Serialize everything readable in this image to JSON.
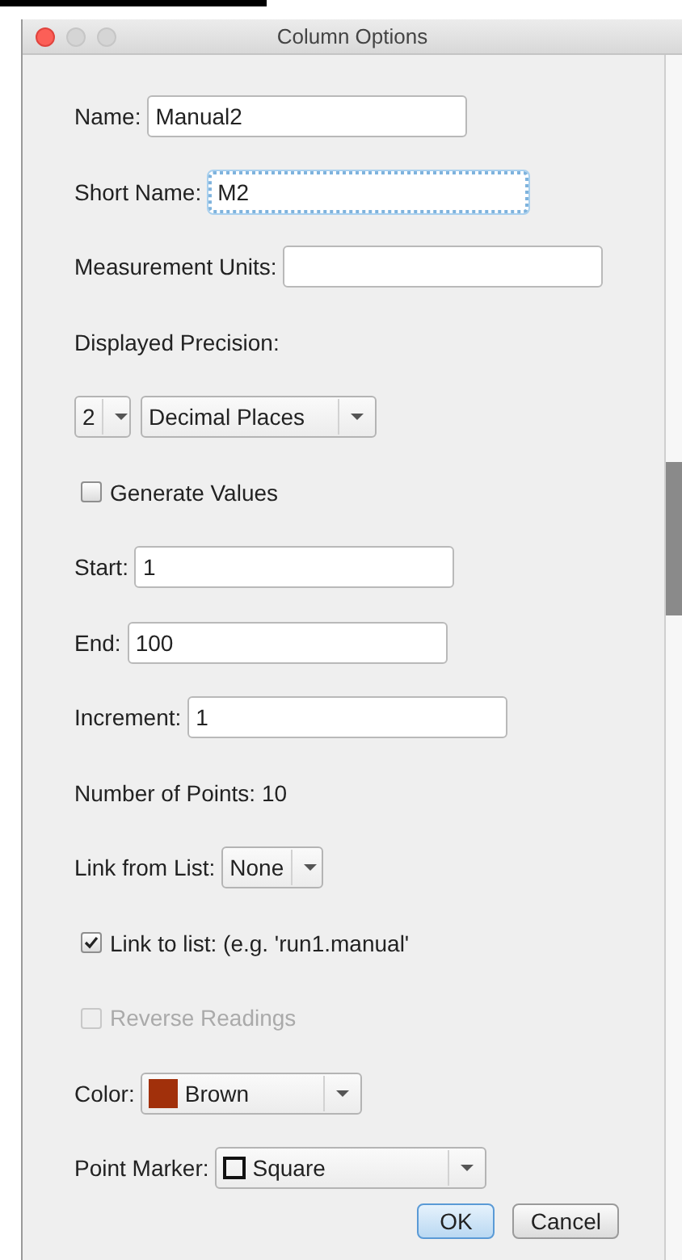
{
  "window": {
    "title": "Column Options"
  },
  "rows": [
    {
      "kind": "field",
      "label": "Name:",
      "value": "Manual2",
      "focused": false
    },
    {
      "kind": "field",
      "label": "Short Name:",
      "value": "M2",
      "focused": true
    },
    {
      "kind": "field",
      "label": "Measurement Units:",
      "focused": false
    },
    {
      "kind": "heading",
      "label": "Displayed Precision:"
    },
    {
      "kind": "selects",
      "selects": [
        {
          "value": "2"
        },
        {
          "value": "Decimal Places"
        }
      ]
    },
    {
      "kind": "checkbox",
      "label": "Generate Values",
      "checked": false,
      "disabled": false
    },
    {
      "kind": "field",
      "label": "Start:",
      "value": "1",
      "focused": false
    },
    {
      "kind": "field",
      "label": "End:",
      "value": "100",
      "focused": false
    },
    {
      "kind": "field",
      "label": "Increment:",
      "value": "1",
      "focused": false
    },
    {
      "kind": "info",
      "label": "Number of Points: 10"
    },
    {
      "kind": "select",
      "label": "Link from List:",
      "value": "None"
    },
    {
      "kind": "checkbox",
      "label": "Link to list: (e.g. 'run1.manual'",
      "checked": true,
      "disabled": false
    },
    {
      "kind": "checkbox",
      "label": "Reverse Readings",
      "checked": false,
      "disabled": true
    },
    {
      "kind": "colorselect",
      "label": "Color:",
      "value": "Brown",
      "color": "#a1300b"
    },
    {
      "kind": "markerselect",
      "label": "Point Marker:",
      "value": "Square"
    }
  ],
  "buttons": [
    {
      "label": "OK",
      "default": true
    },
    {
      "label": "Cancel",
      "default": false
    }
  ]
}
